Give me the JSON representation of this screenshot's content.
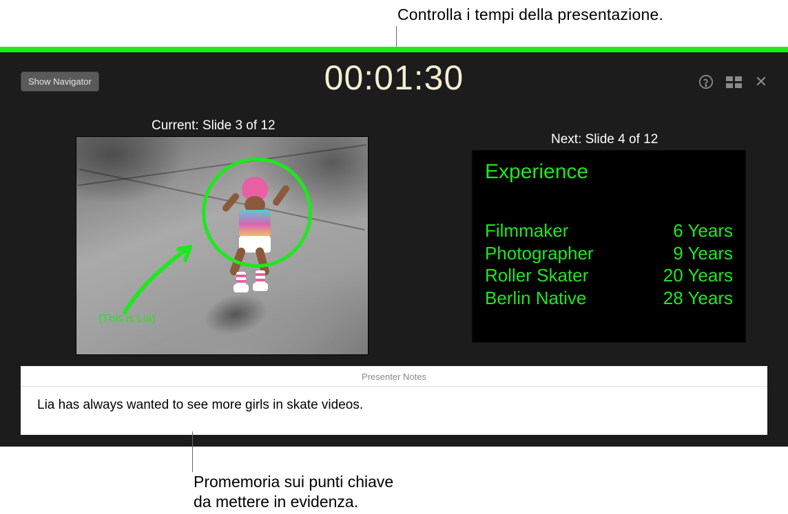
{
  "callouts": {
    "top": "Controlla i tempi della presentazione.",
    "bottom_line1": "Promemoria sui punti chiave",
    "bottom_line2": "da mettere in evidenza."
  },
  "toolbar": {
    "show_navigator": "Show Navigator"
  },
  "timer": "00:01:30",
  "current_slide": {
    "label": "Current: Slide 3 of 12",
    "annotation": "(This is Lia)"
  },
  "next_slide": {
    "label": "Next: Slide 4 of 12",
    "title": "Experience",
    "rows": [
      {
        "role": "Filmmaker",
        "years": "6 Years"
      },
      {
        "role": "Photographer",
        "years": "9 Years"
      },
      {
        "role": "Roller Skater",
        "years": "20 Years"
      },
      {
        "role": "Berlin Native",
        "years": "28 Years"
      }
    ]
  },
  "notes": {
    "header": "Presenter Notes",
    "body": "Lia has always wanted to see more girls in skate videos."
  }
}
